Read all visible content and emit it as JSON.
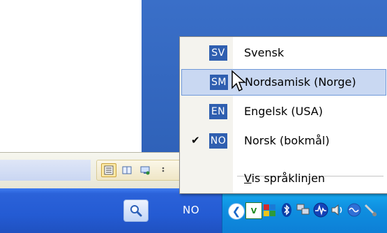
{
  "menu": {
    "items": [
      {
        "code": "SV",
        "label": "Svensk",
        "highlighted": false,
        "checked": false
      },
      {
        "code": "SM",
        "label": "Nordsamisk (Norge)",
        "highlighted": true,
        "checked": false
      },
      {
        "code": "EN",
        "label": "Engelsk (USA)",
        "highlighted": false,
        "checked": false
      },
      {
        "code": "NO",
        "label": "Norsk (bokmål)",
        "highlighted": false,
        "checked": true
      }
    ],
    "show_langbar": {
      "access_key": "V",
      "rest": "is språklinjen"
    }
  },
  "taskbar": {
    "language_indicator": "NO",
    "tray_text_icon": "V"
  },
  "colors": {
    "menu_highlight": "#c9d8f2",
    "lang_code_bg": "#2f5fb0",
    "taskbar_blue": "#245bd3",
    "tray_blue": "#0f8fe0"
  },
  "icons": {
    "search": "search-icon",
    "tray_expand": "chevron-left-icon",
    "bluetooth": "bluetooth-icon",
    "network": "network-icon",
    "volume": "volume-icon"
  }
}
